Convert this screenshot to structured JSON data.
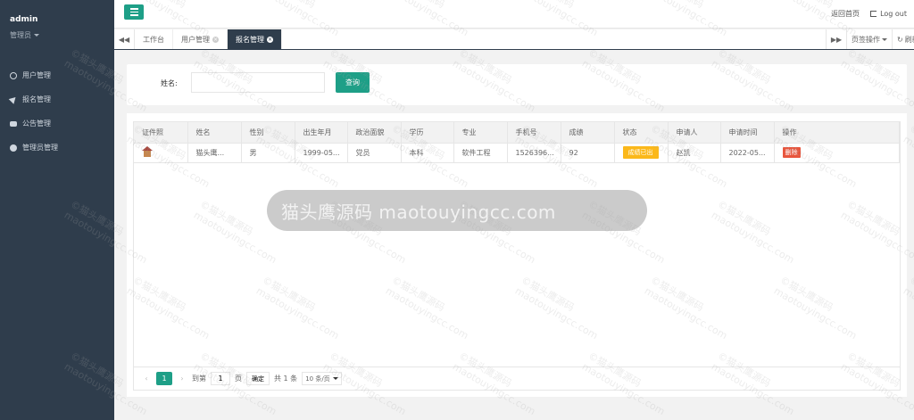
{
  "sidebar": {
    "username": "admin",
    "role": "管理员",
    "items": [
      {
        "label": "用户管理",
        "icon": "user-icon"
      },
      {
        "label": "报名管理",
        "icon": "send-icon"
      },
      {
        "label": "公告管理",
        "icon": "chat-icon"
      },
      {
        "label": "管理员管理",
        "icon": "admin-icon"
      }
    ]
  },
  "header": {
    "home_link": "返回首页",
    "logout": "Log out"
  },
  "tabs": {
    "items": [
      {
        "label": "工作台"
      },
      {
        "label": "用户管理"
      },
      {
        "label": "报名管理"
      }
    ],
    "ops_label": "页签操作",
    "refresh_label": "刷新"
  },
  "search": {
    "label": "姓名:",
    "value": "",
    "button": "查询"
  },
  "table": {
    "columns": [
      "证件照",
      "姓名",
      "性别",
      "出生年月",
      "政治面貌",
      "学历",
      "专业",
      "手机号",
      "成绩",
      "状态",
      "申请人",
      "申请时间",
      "操作"
    ],
    "rows": [
      {
        "name": "猫头鹰...",
        "gender": "男",
        "birth": "1999-05...",
        "political": "党员",
        "education": "本科",
        "major": "软件工程",
        "phone": "1526396...",
        "score": "92",
        "status": "成绩已出",
        "applicant": "赵凯",
        "apply_time": "2022-05...",
        "action": "删除"
      }
    ]
  },
  "pager": {
    "current_page": "1",
    "goto_label": "到第",
    "goto_value": "1",
    "page_unit": "页",
    "confirm": "确定",
    "total": "共 1 条",
    "page_size": "10 条/页"
  },
  "overlay": {
    "text": "猫头鹰源码 maotouyingcc.com"
  },
  "watermark": {
    "line1": "©猫头鹰源码",
    "line2": "maotouyingcc.com"
  },
  "colors": {
    "sidebar_bg": "#2f3d4c",
    "accent": "#1e9f87",
    "status_yellow": "#fbb81a",
    "danger": "#e8553d"
  }
}
